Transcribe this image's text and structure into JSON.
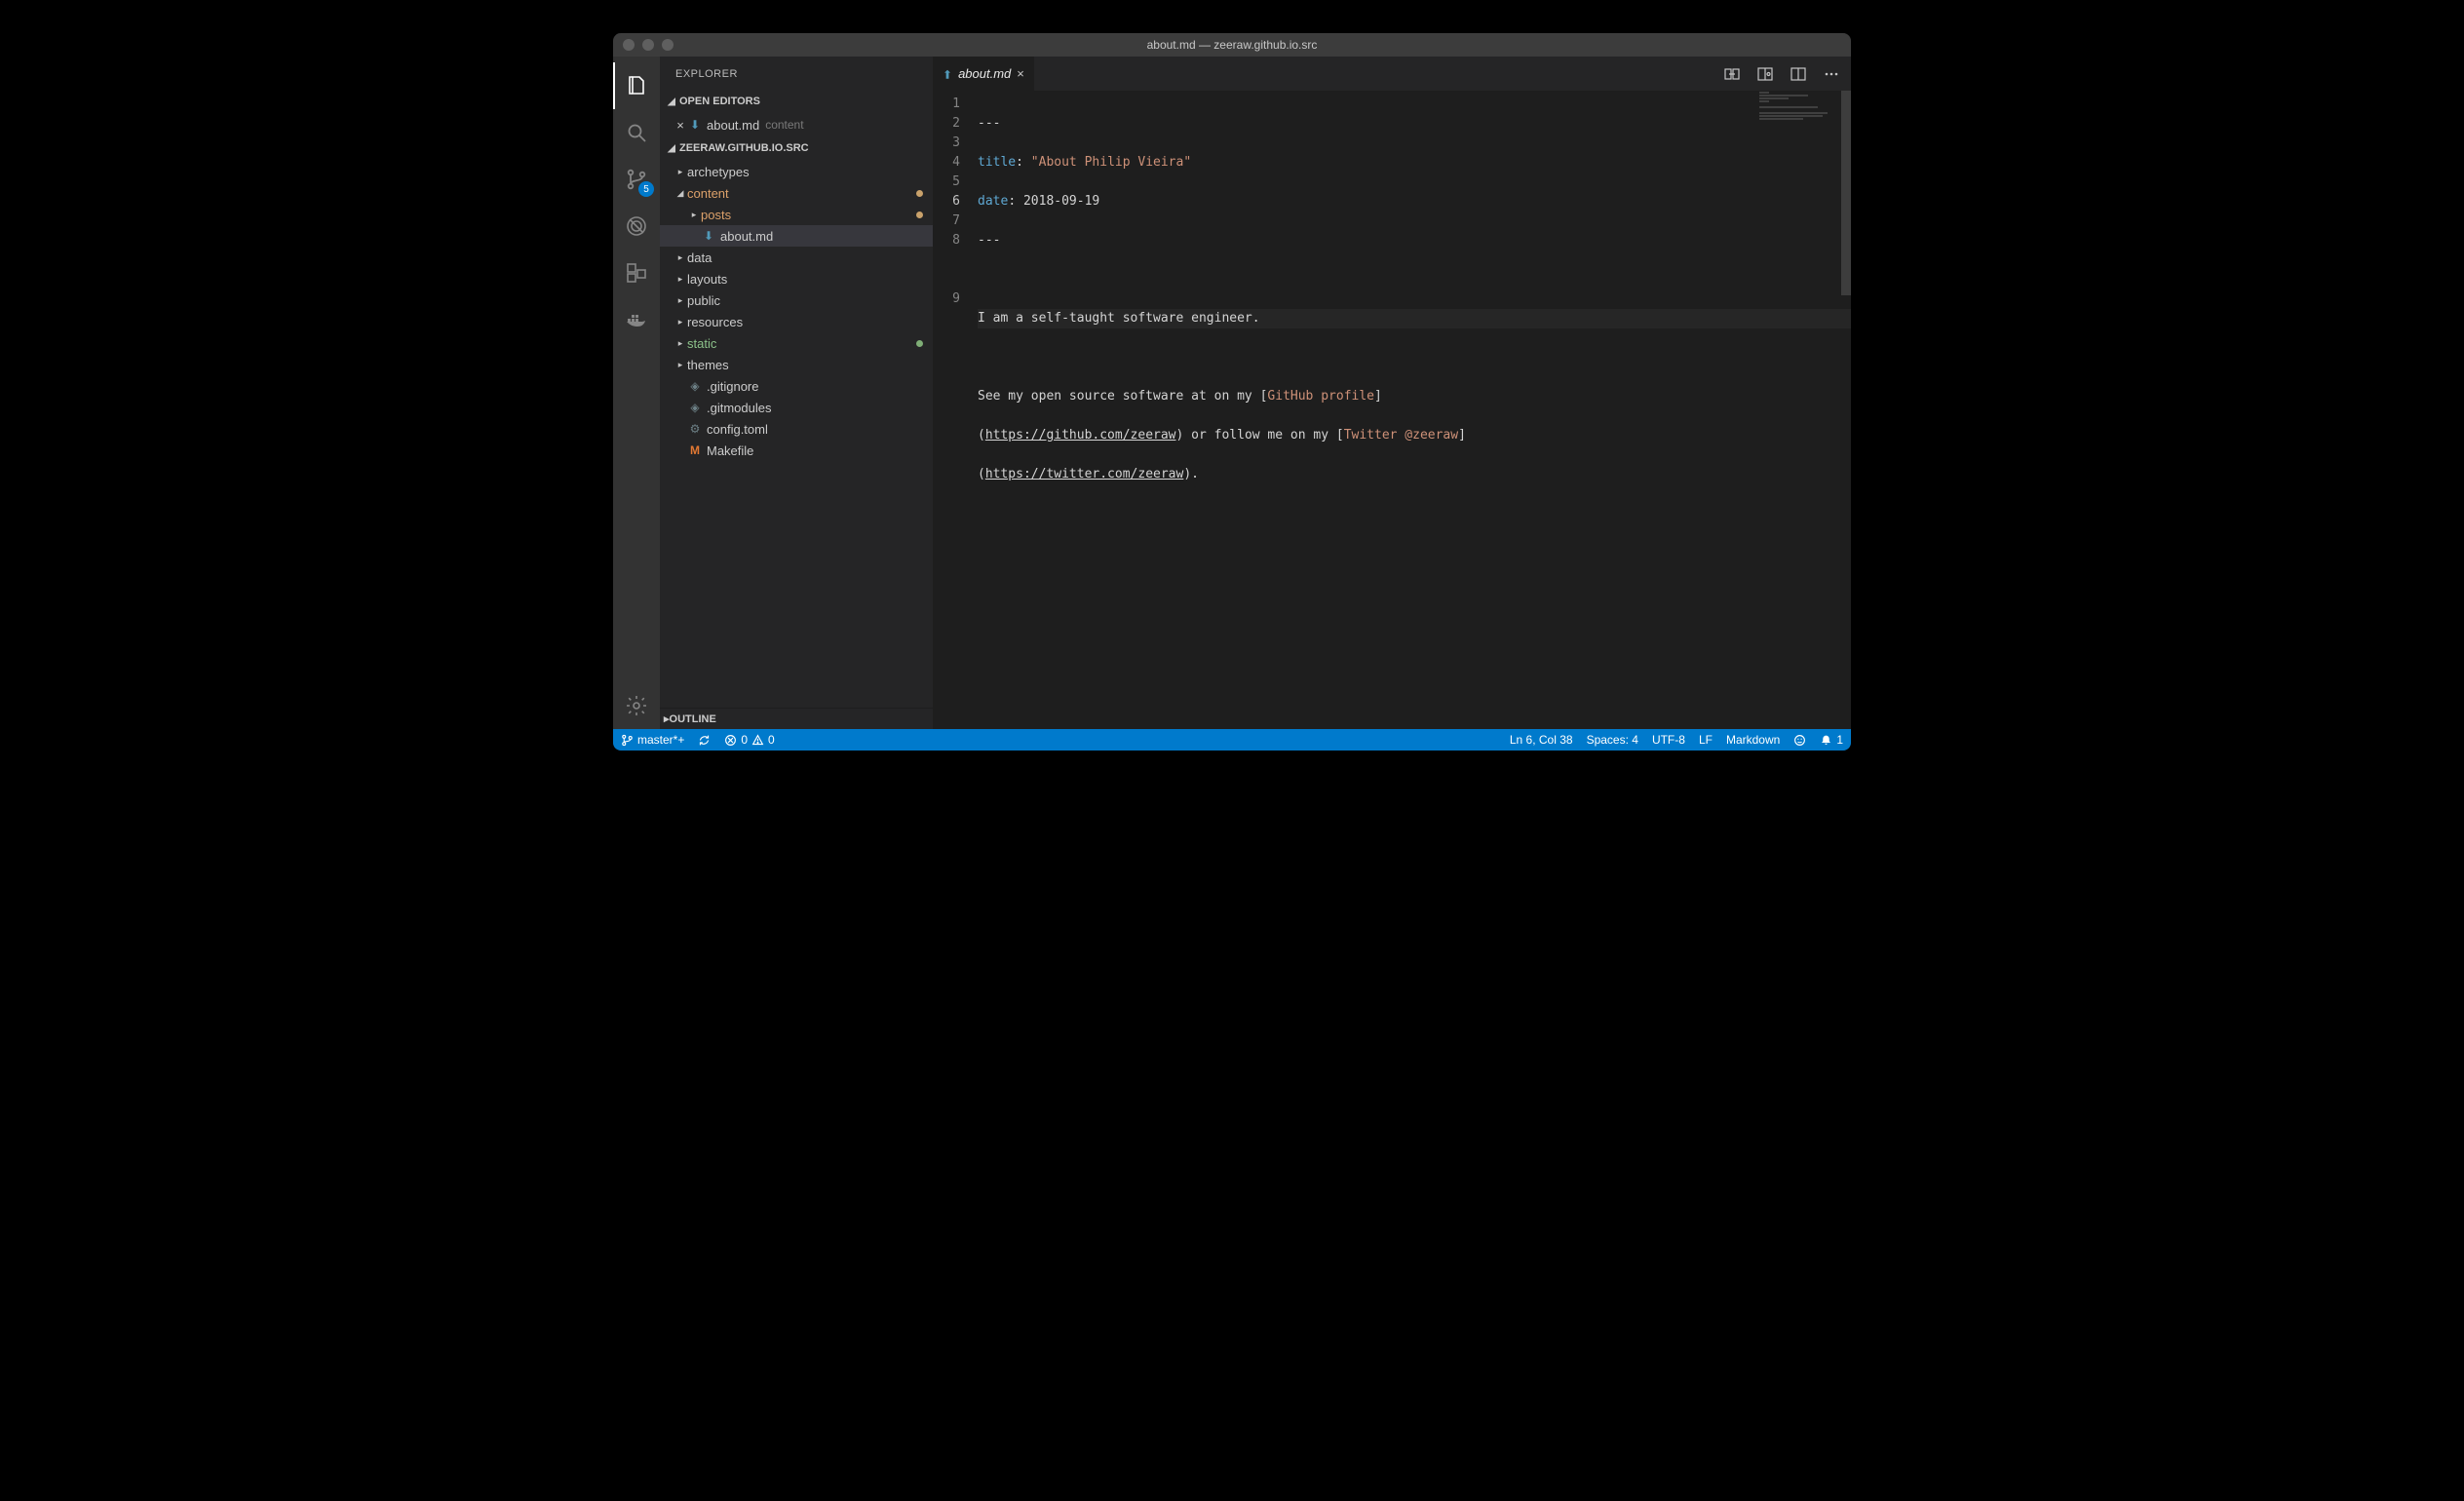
{
  "window": {
    "title": "about.md — zeeraw.github.io.src"
  },
  "activity": {
    "scm_badge": "5"
  },
  "sidebar": {
    "title": "EXPLORER",
    "open_editors_header": "OPEN EDITORS",
    "project_header": "ZEERAW.GITHUB.IO.SRC",
    "outline_header": "OUTLINE",
    "open_editor": {
      "name": "about.md",
      "desc": "content"
    },
    "tree": {
      "archetypes": "archetypes",
      "content": "content",
      "posts": "posts",
      "about": "about.md",
      "data": "data",
      "layouts": "layouts",
      "public": "public",
      "resources": "resources",
      "static": "static",
      "themes": "themes",
      "gitignore": ".gitignore",
      "gitmodules": ".gitmodules",
      "configtoml": "config.toml",
      "makefile": "Makefile"
    }
  },
  "tab": {
    "name": "about.md"
  },
  "editor": {
    "frontmatter_dashes": "---",
    "title_key": "title",
    "title_val": "\"About Philip Vieira\"",
    "date_key": "date",
    "date_val": "2018-09-19",
    "l6": "I am a self-taught software engineer.",
    "l8a": "See my open source software at on my [",
    "l8_link1": "GitHub profile",
    "l8b": "]",
    "l8c_open": "(",
    "l8_url1": "https://github.com/zeeraw",
    "l8c_mid": ") or follow me on my [",
    "l8_link2": "Twitter @zeeraw",
    "l8c_close": "]",
    "l8d_open": "(",
    "l8_url2": "https://twitter.com/zeeraw",
    "l8d_close": ")."
  },
  "status": {
    "branch": "master*+",
    "errors": "0",
    "warnings": "0",
    "lncol": "Ln 6, Col 38",
    "spaces": "Spaces: 4",
    "encoding": "UTF-8",
    "eol": "LF",
    "lang": "Markdown",
    "notifications": "1"
  }
}
